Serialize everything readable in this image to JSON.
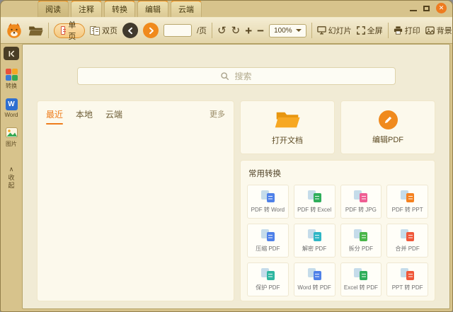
{
  "titlebar": {
    "tabs": [
      {
        "label": "阅读"
      },
      {
        "label": "注释"
      },
      {
        "label": "转换"
      },
      {
        "label": "编辑"
      },
      {
        "label": "云端"
      }
    ]
  },
  "toolbar": {
    "single_page": "单页",
    "double_page": "双页",
    "page_value": "",
    "page_suffix": "/页",
    "zoom_value": "100%",
    "slideshow": "幻灯片",
    "fullscreen": "全屏",
    "print": "打印",
    "background": "背景"
  },
  "sidebar": {
    "items": [
      {
        "label": "转换"
      },
      {
        "label": "Word"
      },
      {
        "label": "图片"
      }
    ],
    "collapse_label": "收起"
  },
  "search": {
    "placeholder": "搜索"
  },
  "files": {
    "tabs": [
      {
        "label": "最近"
      },
      {
        "label": "本地"
      },
      {
        "label": "云端"
      }
    ],
    "more": "更多"
  },
  "quick_actions": [
    {
      "label": "打开文档"
    },
    {
      "label": "编辑PDF"
    }
  ],
  "conversions": {
    "title": "常用转换",
    "items": [
      {
        "label": "PDF 转 Word",
        "color": "#4f81e8"
      },
      {
        "label": "PDF 转 Excel",
        "color": "#2fae5b"
      },
      {
        "label": "PDF 转 JPG",
        "color": "#ef5e93"
      },
      {
        "label": "PDF 转 PPT",
        "color": "#f58220"
      },
      {
        "label": "压缩 PDF",
        "color": "#4f81e8"
      },
      {
        "label": "解密 PDF",
        "color": "#2fb6c5"
      },
      {
        "label": "拆分 PDF",
        "color": "#49b649"
      },
      {
        "label": "合并 PDF",
        "color": "#f0583a"
      },
      {
        "label": "保护 PDF",
        "color": "#2fb6a0"
      },
      {
        "label": "Word 转 PDF",
        "color": "#4f81e8"
      },
      {
        "label": "Excel 转 PDF",
        "color": "#2fae5b"
      },
      {
        "label": "PPT 转 PDF",
        "color": "#f0583a"
      }
    ]
  },
  "colors": {
    "accent": "#ee8022",
    "frame": "#d7c38c"
  }
}
